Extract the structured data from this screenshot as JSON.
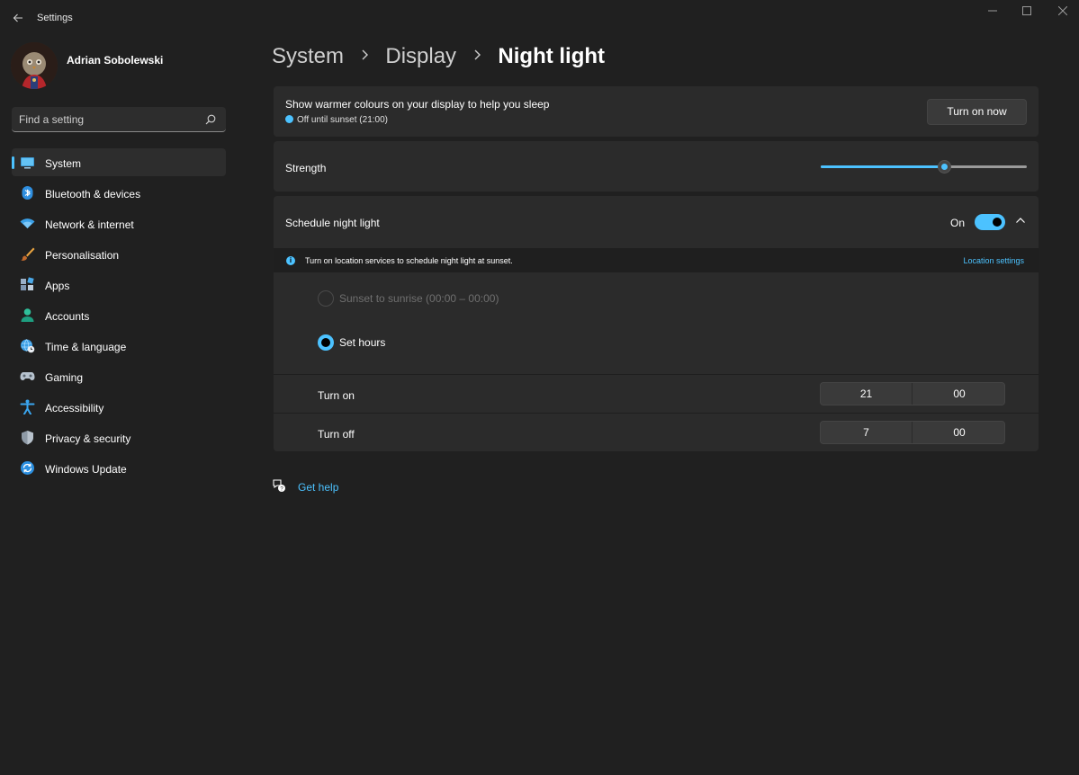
{
  "window": {
    "title": "Settings",
    "back_icon": "back-arrow-icon",
    "controls": [
      "minimize-icon",
      "maximize-icon",
      "close-icon"
    ]
  },
  "profile": {
    "name": "Adrian Sobolewski"
  },
  "search": {
    "placeholder": "Find a setting"
  },
  "sidebar": {
    "items": [
      {
        "label": "System",
        "icon": "monitor-icon",
        "active": true
      },
      {
        "label": "Bluetooth & devices",
        "icon": "bluetooth-icon"
      },
      {
        "label": "Network & internet",
        "icon": "wifi-icon"
      },
      {
        "label": "Personalisation",
        "icon": "brush-icon"
      },
      {
        "label": "Apps",
        "icon": "apps-icon"
      },
      {
        "label": "Accounts",
        "icon": "person-icon"
      },
      {
        "label": "Time & language",
        "icon": "globe-clock-icon"
      },
      {
        "label": "Gaming",
        "icon": "gamepad-icon"
      },
      {
        "label": "Accessibility",
        "icon": "accessibility-icon"
      },
      {
        "label": "Privacy & security",
        "icon": "shield-icon"
      },
      {
        "label": "Windows Update",
        "icon": "update-icon"
      }
    ]
  },
  "breadcrumb": {
    "items": [
      "System",
      "Display",
      "Night light"
    ]
  },
  "night_light": {
    "description": "Show warmer colours on your display to help you sleep",
    "status": "Off until sunset (21:00)",
    "turn_on_button": "Turn on now",
    "strength_label": "Strength",
    "strength_value": 0.6,
    "schedule_label": "Schedule night light",
    "schedule_state": "On",
    "schedule_enabled": true,
    "info_text": "Turn on location services to schedule night light at sunset.",
    "location_link": "Location settings",
    "option_sunset": "Sunset to sunrise (00:00 – 00:00)",
    "option_set_hours": "Set hours",
    "selected_option": "Set hours",
    "turn_on_label": "Turn on",
    "turn_on_hour": "21",
    "turn_on_minute": "00",
    "turn_off_label": "Turn off",
    "turn_off_hour": "7",
    "turn_off_minute": "00"
  },
  "help": {
    "label": "Get help"
  },
  "colors": {
    "accent": "#4cc2ff",
    "background": "#202020",
    "card": "#2b2b2b"
  }
}
